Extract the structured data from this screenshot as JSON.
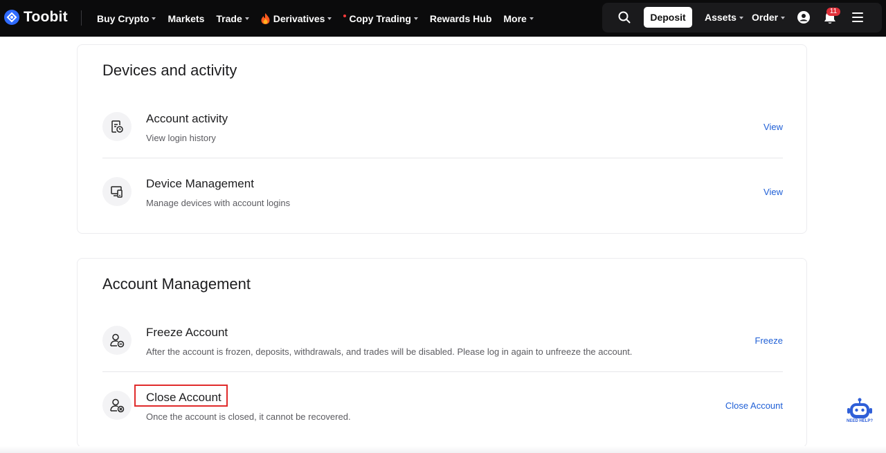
{
  "nav": {
    "brand": "Toobit",
    "menu": [
      {
        "label": "Buy Crypto",
        "dropdown": true
      },
      {
        "label": "Markets",
        "dropdown": false
      },
      {
        "label": "Trade",
        "dropdown": true
      },
      {
        "label": "Derivatives",
        "dropdown": true,
        "icon": "flame-icon"
      },
      {
        "label": "Copy Trading",
        "dropdown": true,
        "dot": true
      },
      {
        "label": "Rewards Hub",
        "dropdown": false
      },
      {
        "label": "More",
        "dropdown": true
      }
    ],
    "deposit_label": "Deposit",
    "assets_label": "Assets",
    "order_label": "Order",
    "notification_count": "11"
  },
  "devices_card": {
    "title": "Devices and activity",
    "rows": [
      {
        "title": "Account activity",
        "desc": "View login history",
        "action": "View",
        "icon": "document-clock-icon"
      },
      {
        "title": "Device Management",
        "desc": "Manage devices with account logins",
        "action": "View",
        "icon": "devices-icon"
      }
    ]
  },
  "account_card": {
    "title": "Account Management",
    "rows": [
      {
        "title": "Freeze Account",
        "desc": "After the account is frozen, deposits, withdrawals, and trades will be disabled. Please log in again to unfreeze the account.",
        "action": "Freeze",
        "icon": "user-freeze-icon"
      },
      {
        "title": "Close Account",
        "desc": "Once the account is closed, it cannot be recovered.",
        "action": "Close Account",
        "icon": "user-close-icon"
      }
    ]
  },
  "help": {
    "label": "NEED HELP?"
  },
  "colors": {
    "accent": "#1f5fd6",
    "nav_bg": "#0b0b0c",
    "highlight": "#e02a2a"
  }
}
